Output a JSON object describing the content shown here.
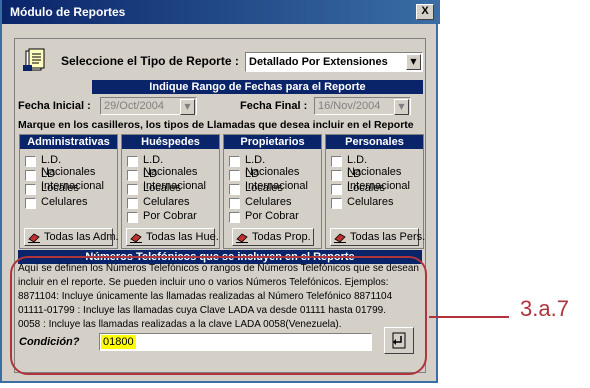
{
  "window": {
    "title": "Módulo de Reportes",
    "close_label": "X"
  },
  "report_type": {
    "label": "Seleccione el Tipo de Reporte :",
    "value": "Detallado Por Extensiones"
  },
  "date_range": {
    "header": "Indique Rango de Fechas para el Reporte",
    "start_label": "Fecha Inicial :",
    "start_value": "29/Oct/2004",
    "end_label": "Fecha Final :",
    "end_value": "16/Nov/2004"
  },
  "instructions": "Marque en los casilleros, los tipos de Llamadas que desea incluir en el Reporte",
  "columns": [
    {
      "header": "Administrativas",
      "items": [
        "L.D. Nacionales",
        "LD Internacional",
        "Locales",
        "Celulares"
      ],
      "button": "Todas las Adm."
    },
    {
      "header": "Huéspedes",
      "items": [
        "L.D. Nacionales",
        "LD Internacional",
        "Locales",
        "Celulares",
        "Por Cobrar"
      ],
      "button": "Todas las Hue."
    },
    {
      "header": "Propietarios",
      "items": [
        "L.D. Nacionales",
        "LD Internacional",
        "Locales",
        "Celulares",
        "Por Cobrar"
      ],
      "button": "Todas Prop."
    },
    {
      "header": "Personales",
      "items": [
        "L.D. Nacionales",
        "LD Internacional",
        "Locales",
        "Celulares"
      ],
      "button": "Todas las Pers."
    }
  ],
  "phones": {
    "header": "Números Telefónicos que se incluyen en el Reporte",
    "lines": [
      "Aquí se definen los Números Telefónicos o rangos de Números Telefónicos que se desean",
      "incluir en el reporte. Se pueden incluir uno o varios Números Telefónicos. Ejemplos:",
      "8871104: Incluye únicamente las llamadas realizadas al Número Telefónico 8871104",
      "01111-01799 : Incluye las llamadas cuya Clave LADA va desde 01111 hasta 01799.",
      "0058 : Incluye las llamadas realizadas a la clave LADA 0058(Venezuela)."
    ],
    "condition_label": "Condición?",
    "condition_value": "01800"
  },
  "callout": {
    "label": "3.a.7"
  },
  "colors": {
    "title_bar": "#0a246a",
    "panel": "#d4d0c8",
    "annotation": "#b0343c",
    "highlight": "#ffff00"
  }
}
